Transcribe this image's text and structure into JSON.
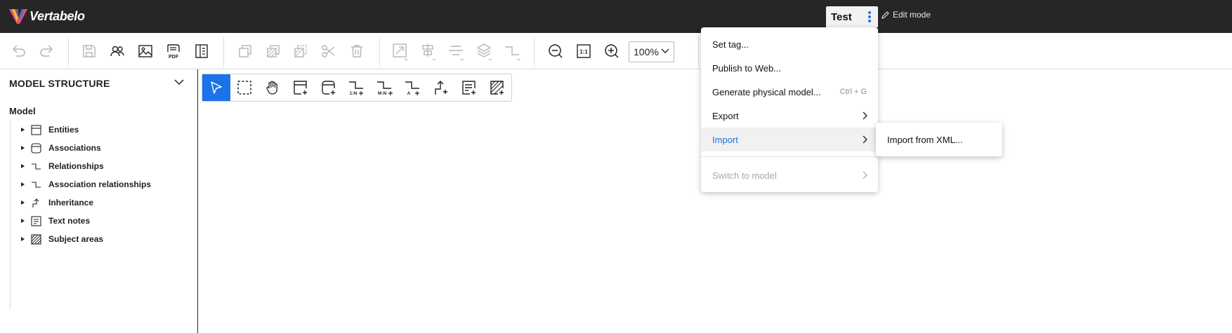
{
  "app": {
    "logo_text": "Vertabelo"
  },
  "header": {
    "model_name": "Test",
    "edit_mode_label": "Edit mode"
  },
  "toolbar": {
    "zoom_value": "100%",
    "fit_label": "1:1",
    "pdf_label": "PDF"
  },
  "sidebar": {
    "title": "MODEL STRUCTURE",
    "root_label": "Model",
    "items": [
      {
        "label": "Entities",
        "icon": "entity-icon"
      },
      {
        "label": "Associations",
        "icon": "association-icon"
      },
      {
        "label": "Relationships",
        "icon": "relationship-icon"
      },
      {
        "label": "Association relationships",
        "icon": "association-relationship-icon"
      },
      {
        "label": "Inheritance",
        "icon": "inheritance-icon"
      },
      {
        "label": "Text notes",
        "icon": "text-note-icon"
      },
      {
        "label": "Subject areas",
        "icon": "subject-area-icon"
      }
    ]
  },
  "palette": {
    "rel_1n_label": "1:N",
    "rel_mn_label": "M:N",
    "rel_a_label": "A"
  },
  "menu": {
    "items": [
      {
        "label": "Set tag..."
      },
      {
        "label": "Publish to Web..."
      },
      {
        "label": "Generate physical model...",
        "shortcut": "Ctrl + G"
      },
      {
        "label": "Export"
      },
      {
        "label": "Import"
      },
      {
        "label": "Switch to model"
      }
    ],
    "submenu": {
      "label": "Import from XML..."
    }
  },
  "colors": {
    "accent": "#1a73e8",
    "topbar": "#262626"
  }
}
